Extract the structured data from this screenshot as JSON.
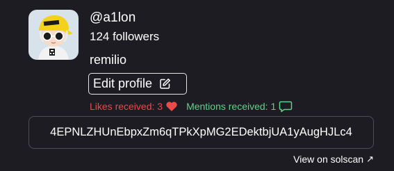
{
  "profile": {
    "username": "@a1lon",
    "followers": "124 followers",
    "display_name": "remilio",
    "avatar_icon": "remilio-avatar-icon"
  },
  "actions": {
    "edit_profile_label": "Edit profile",
    "edit_icon": "edit-icon"
  },
  "stats": {
    "likes_text": "Likes received: 3",
    "likes_icon": "heart-icon",
    "mentions_text": "Mentions received: 1",
    "mentions_icon": "speech-bubble-icon"
  },
  "wallet": {
    "address": "4EPNLZHUnEbpxZm6qTPkXpMG2EDektbjUA1yAugHJLc4"
  },
  "links": {
    "solscan_label": "View on solscan",
    "solscan_arrow": "↗"
  },
  "colors": {
    "background": "#1d1c22",
    "likes": "#ea4a4a",
    "mentions": "#5fd38a",
    "border": "#4e4d56"
  }
}
